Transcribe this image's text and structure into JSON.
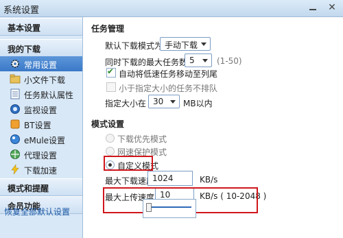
{
  "window": {
    "title": "系统设置",
    "close_glyph": "✕"
  },
  "sidebar": {
    "sections": [
      {
        "label": "基本设置"
      },
      {
        "label": "我的下载"
      },
      {
        "label": "模式和提醒"
      },
      {
        "label": "会员功能"
      }
    ],
    "items": [
      {
        "label": "常用设置",
        "icon": "gear-icon",
        "selected": true
      },
      {
        "label": "小文件下载",
        "icon": "folder-icon"
      },
      {
        "label": "任务默认属性",
        "icon": "list-icon"
      },
      {
        "label": "监视设置",
        "icon": "monitor-icon"
      },
      {
        "label": "BT设置",
        "icon": "bt-icon"
      },
      {
        "label": "eMule设置",
        "icon": "emule-icon"
      },
      {
        "label": "代理设置",
        "icon": "proxy-icon"
      },
      {
        "label": "下载加速",
        "icon": "lightning-icon"
      }
    ],
    "restore_label": "恢复全部默认设置"
  },
  "task": {
    "heading": "任务管理",
    "default_mode_label": "默认下载模式为",
    "default_mode_value": "手动下载",
    "max_tasks_label": "同时下载的最大任务数",
    "max_tasks_value": "5",
    "max_tasks_range": "(1-50)",
    "auto_move_label": "自动将低速任务移动至列尾",
    "auto_move_checked": true,
    "small_no_queue_label": "小于指定大小的任务不排队",
    "small_no_queue_checked": false,
    "size_label": "指定大小在",
    "size_value": "30",
    "size_unit": "MB以内"
  },
  "mode": {
    "heading": "模式设置",
    "options": [
      {
        "label": "下载优先模式",
        "selected": false
      },
      {
        "label": "网速保护模式",
        "selected": false
      },
      {
        "label": "自定义模式",
        "selected": true
      }
    ],
    "max_down_label": "最大下载速度",
    "max_down_value": "1024",
    "max_down_unit": "KB/s",
    "max_up_label": "最大上传速度",
    "max_up_value": "10",
    "max_up_unit": "KB/s ( 10-2048 )",
    "slider_fraction": 0.0
  },
  "colors": {
    "accent": "#3b79c8",
    "highlight": "#d0161b"
  }
}
